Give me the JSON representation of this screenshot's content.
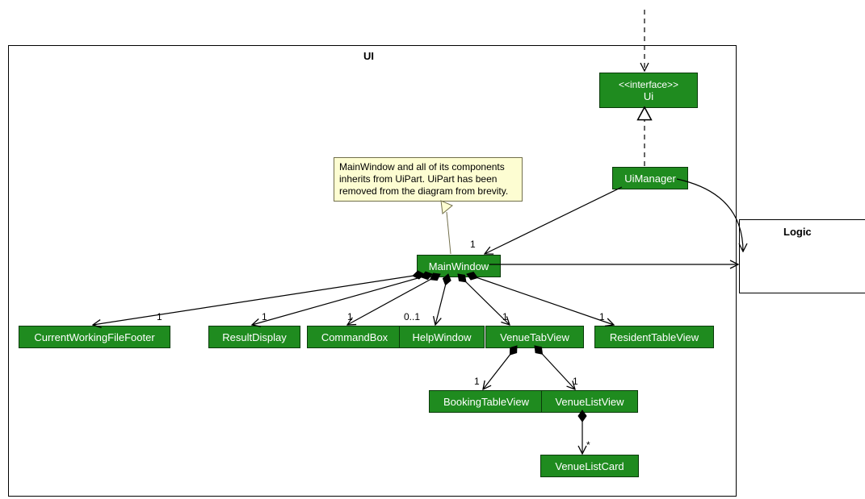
{
  "package": {
    "name": "UI"
  },
  "external": {
    "logic": "Logic"
  },
  "interface": {
    "stereotype": "<<interface>>",
    "name": "Ui"
  },
  "nodes": {
    "uiManager": "UiManager",
    "mainWindow": "MainWindow",
    "currentWorkingFileFooter": "CurrentWorkingFileFooter",
    "resultDisplay": "ResultDisplay",
    "commandBox": "CommandBox",
    "helpWindow": "HelpWindow",
    "venueTabView": "VenueTabView",
    "residentTableView": "ResidentTableView",
    "bookingTableView": "BookingTableView",
    "venueListView": "VenueListView",
    "venueListCard": "VenueListCard"
  },
  "note": {
    "text": "MainWindow and all of its components inherits from UiPart. UiPart has been removed from the diagram from brevity."
  },
  "mult": {
    "mwTop": "1",
    "cwff": "1",
    "rd": "1",
    "cb": "1",
    "hw": "0..1",
    "vtv": "1",
    "rtv": "1",
    "btv": "1",
    "vlv": "1",
    "vlc": "*"
  }
}
